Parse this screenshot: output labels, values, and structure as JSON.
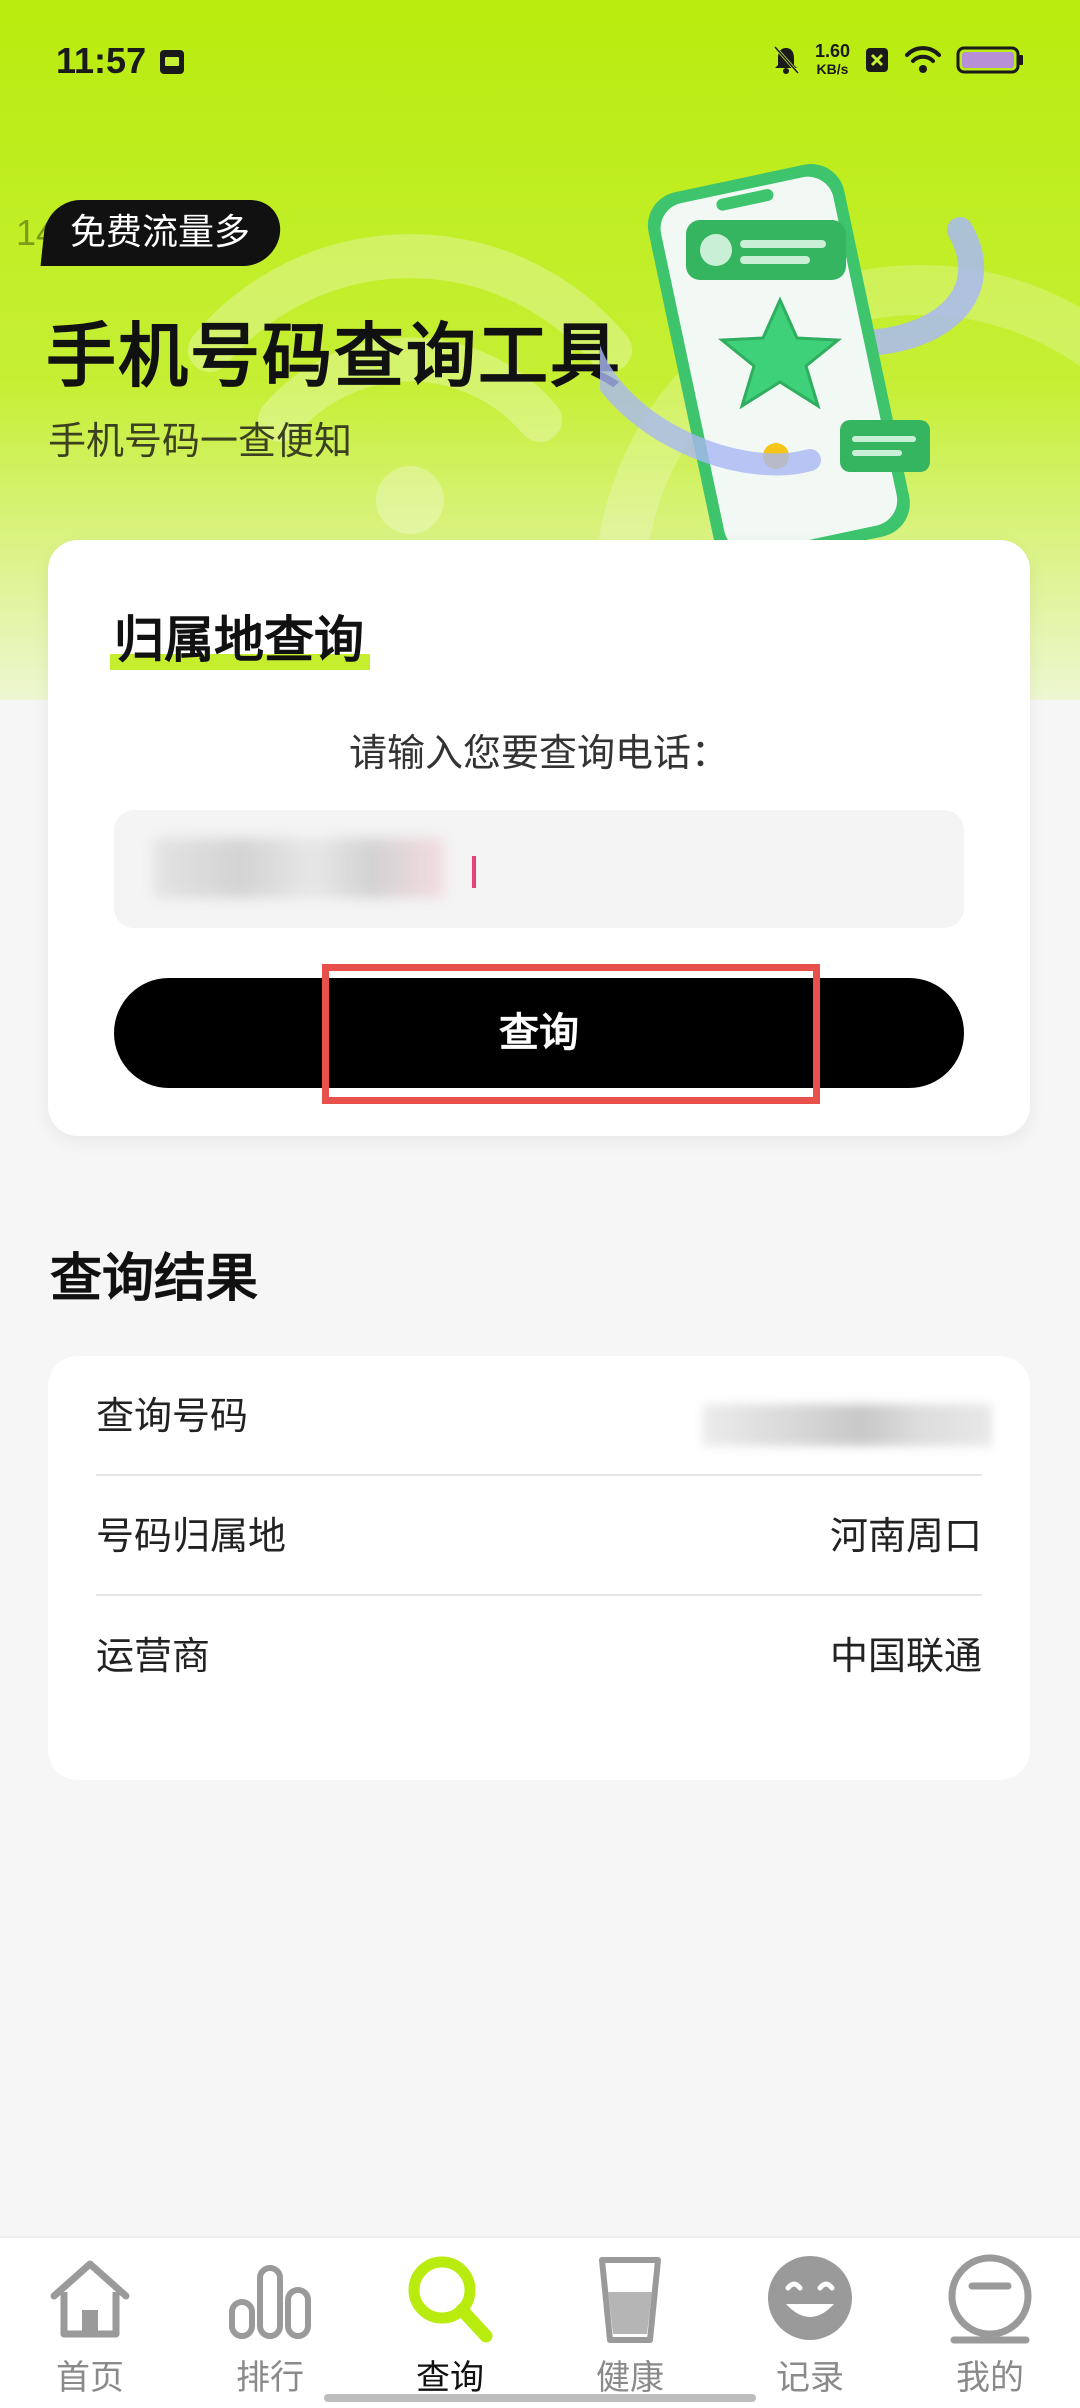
{
  "status_bar": {
    "time": "11:57",
    "net_speed_value": "1.60",
    "net_speed_unit": "KB/s"
  },
  "hero": {
    "ghost_text": "14",
    "badge": "免费流量多",
    "title": "手机号码查询工具",
    "subtitle": "手机号码一查便知"
  },
  "query_card": {
    "heading": "归属地查询",
    "prompt": "请输入您要查询电话：",
    "button_label": "查询"
  },
  "results": {
    "title": "查询结果",
    "rows": [
      {
        "label": "查询号码",
        "value": ""
      },
      {
        "label": "号码归属地",
        "value": "河南周口"
      },
      {
        "label": "运营商",
        "value": "中国联通"
      }
    ]
  },
  "bottom_nav": {
    "items": [
      {
        "label": "首页",
        "icon": "home-icon"
      },
      {
        "label": "排行",
        "icon": "bar-chart-icon"
      },
      {
        "label": "查询",
        "icon": "search-icon",
        "active": true
      },
      {
        "label": "健康",
        "icon": "glass-icon"
      },
      {
        "label": "记录",
        "icon": "smile-icon"
      },
      {
        "label": "我的",
        "icon": "face-icon"
      }
    ]
  },
  "colors": {
    "accent": "#b9ec0e",
    "highlight_border": "#e8504c",
    "button_bg": "#000000"
  }
}
